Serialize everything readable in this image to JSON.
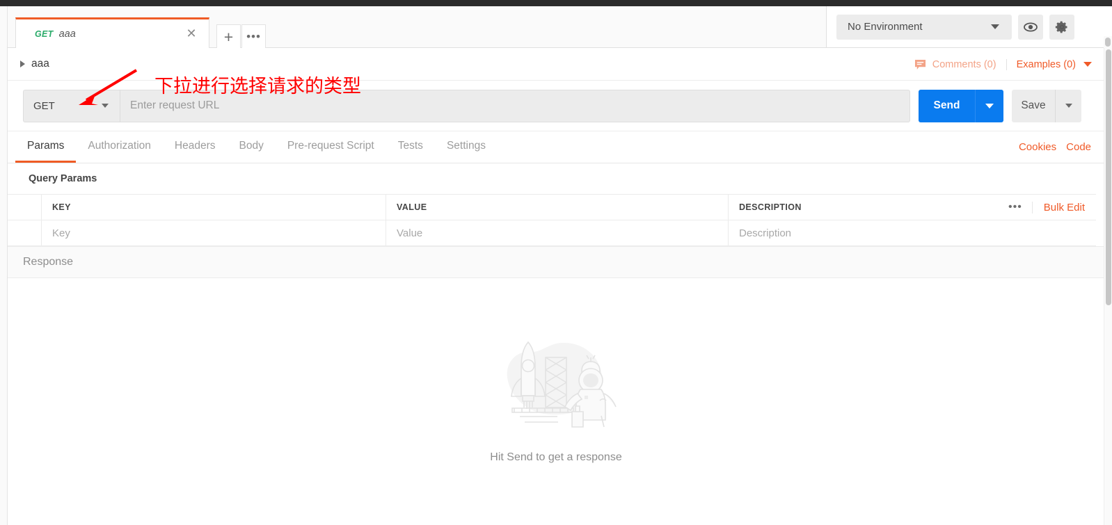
{
  "window": {
    "tab": {
      "method": "GET",
      "name": "aaa",
      "close_icon": "close-icon",
      "add_icon": "plus-icon",
      "more_icon": "ellipsis-icon"
    },
    "environment": {
      "selected": "No Environment",
      "eye_icon": "eye-icon",
      "settings_icon": "gear-icon"
    }
  },
  "breadcrumb": {
    "name": "aaa",
    "comments": "Comments (0)",
    "comments_icon": "comment-icon",
    "examples": "Examples (0)"
  },
  "request": {
    "method": "GET",
    "url_placeholder": "Enter request URL",
    "send_label": "Send",
    "save_label": "Save"
  },
  "tabs": [
    {
      "label": "Params",
      "active": true
    },
    {
      "label": "Authorization",
      "active": false
    },
    {
      "label": "Headers",
      "active": false
    },
    {
      "label": "Body",
      "active": false
    },
    {
      "label": "Pre-request Script",
      "active": false
    },
    {
      "label": "Tests",
      "active": false
    },
    {
      "label": "Settings",
      "active": false
    }
  ],
  "tab_links": {
    "cookies": "Cookies",
    "code": "Code"
  },
  "query_params": {
    "title": "Query Params",
    "columns": [
      "KEY",
      "VALUE",
      "DESCRIPTION"
    ],
    "placeholder_row": [
      "Key",
      "Value",
      "Description"
    ],
    "more_icon": "ellipsis-icon",
    "bulk_edit": "Bulk Edit"
  },
  "response": {
    "title": "Response",
    "empty_illustration": "rocket-launchpad-astronaut-illustration",
    "empty_text": "Hit Send to get a response"
  },
  "annotation": {
    "text": "下拉进行选择请求的类型",
    "arrow": "red-arrow",
    "color": "#ff0000"
  },
  "colors": {
    "accent_orange": "#ef5b25",
    "send_blue": "#0a7bef",
    "method_green": "#2bab6a",
    "titlebar": "#2b2b2b"
  }
}
